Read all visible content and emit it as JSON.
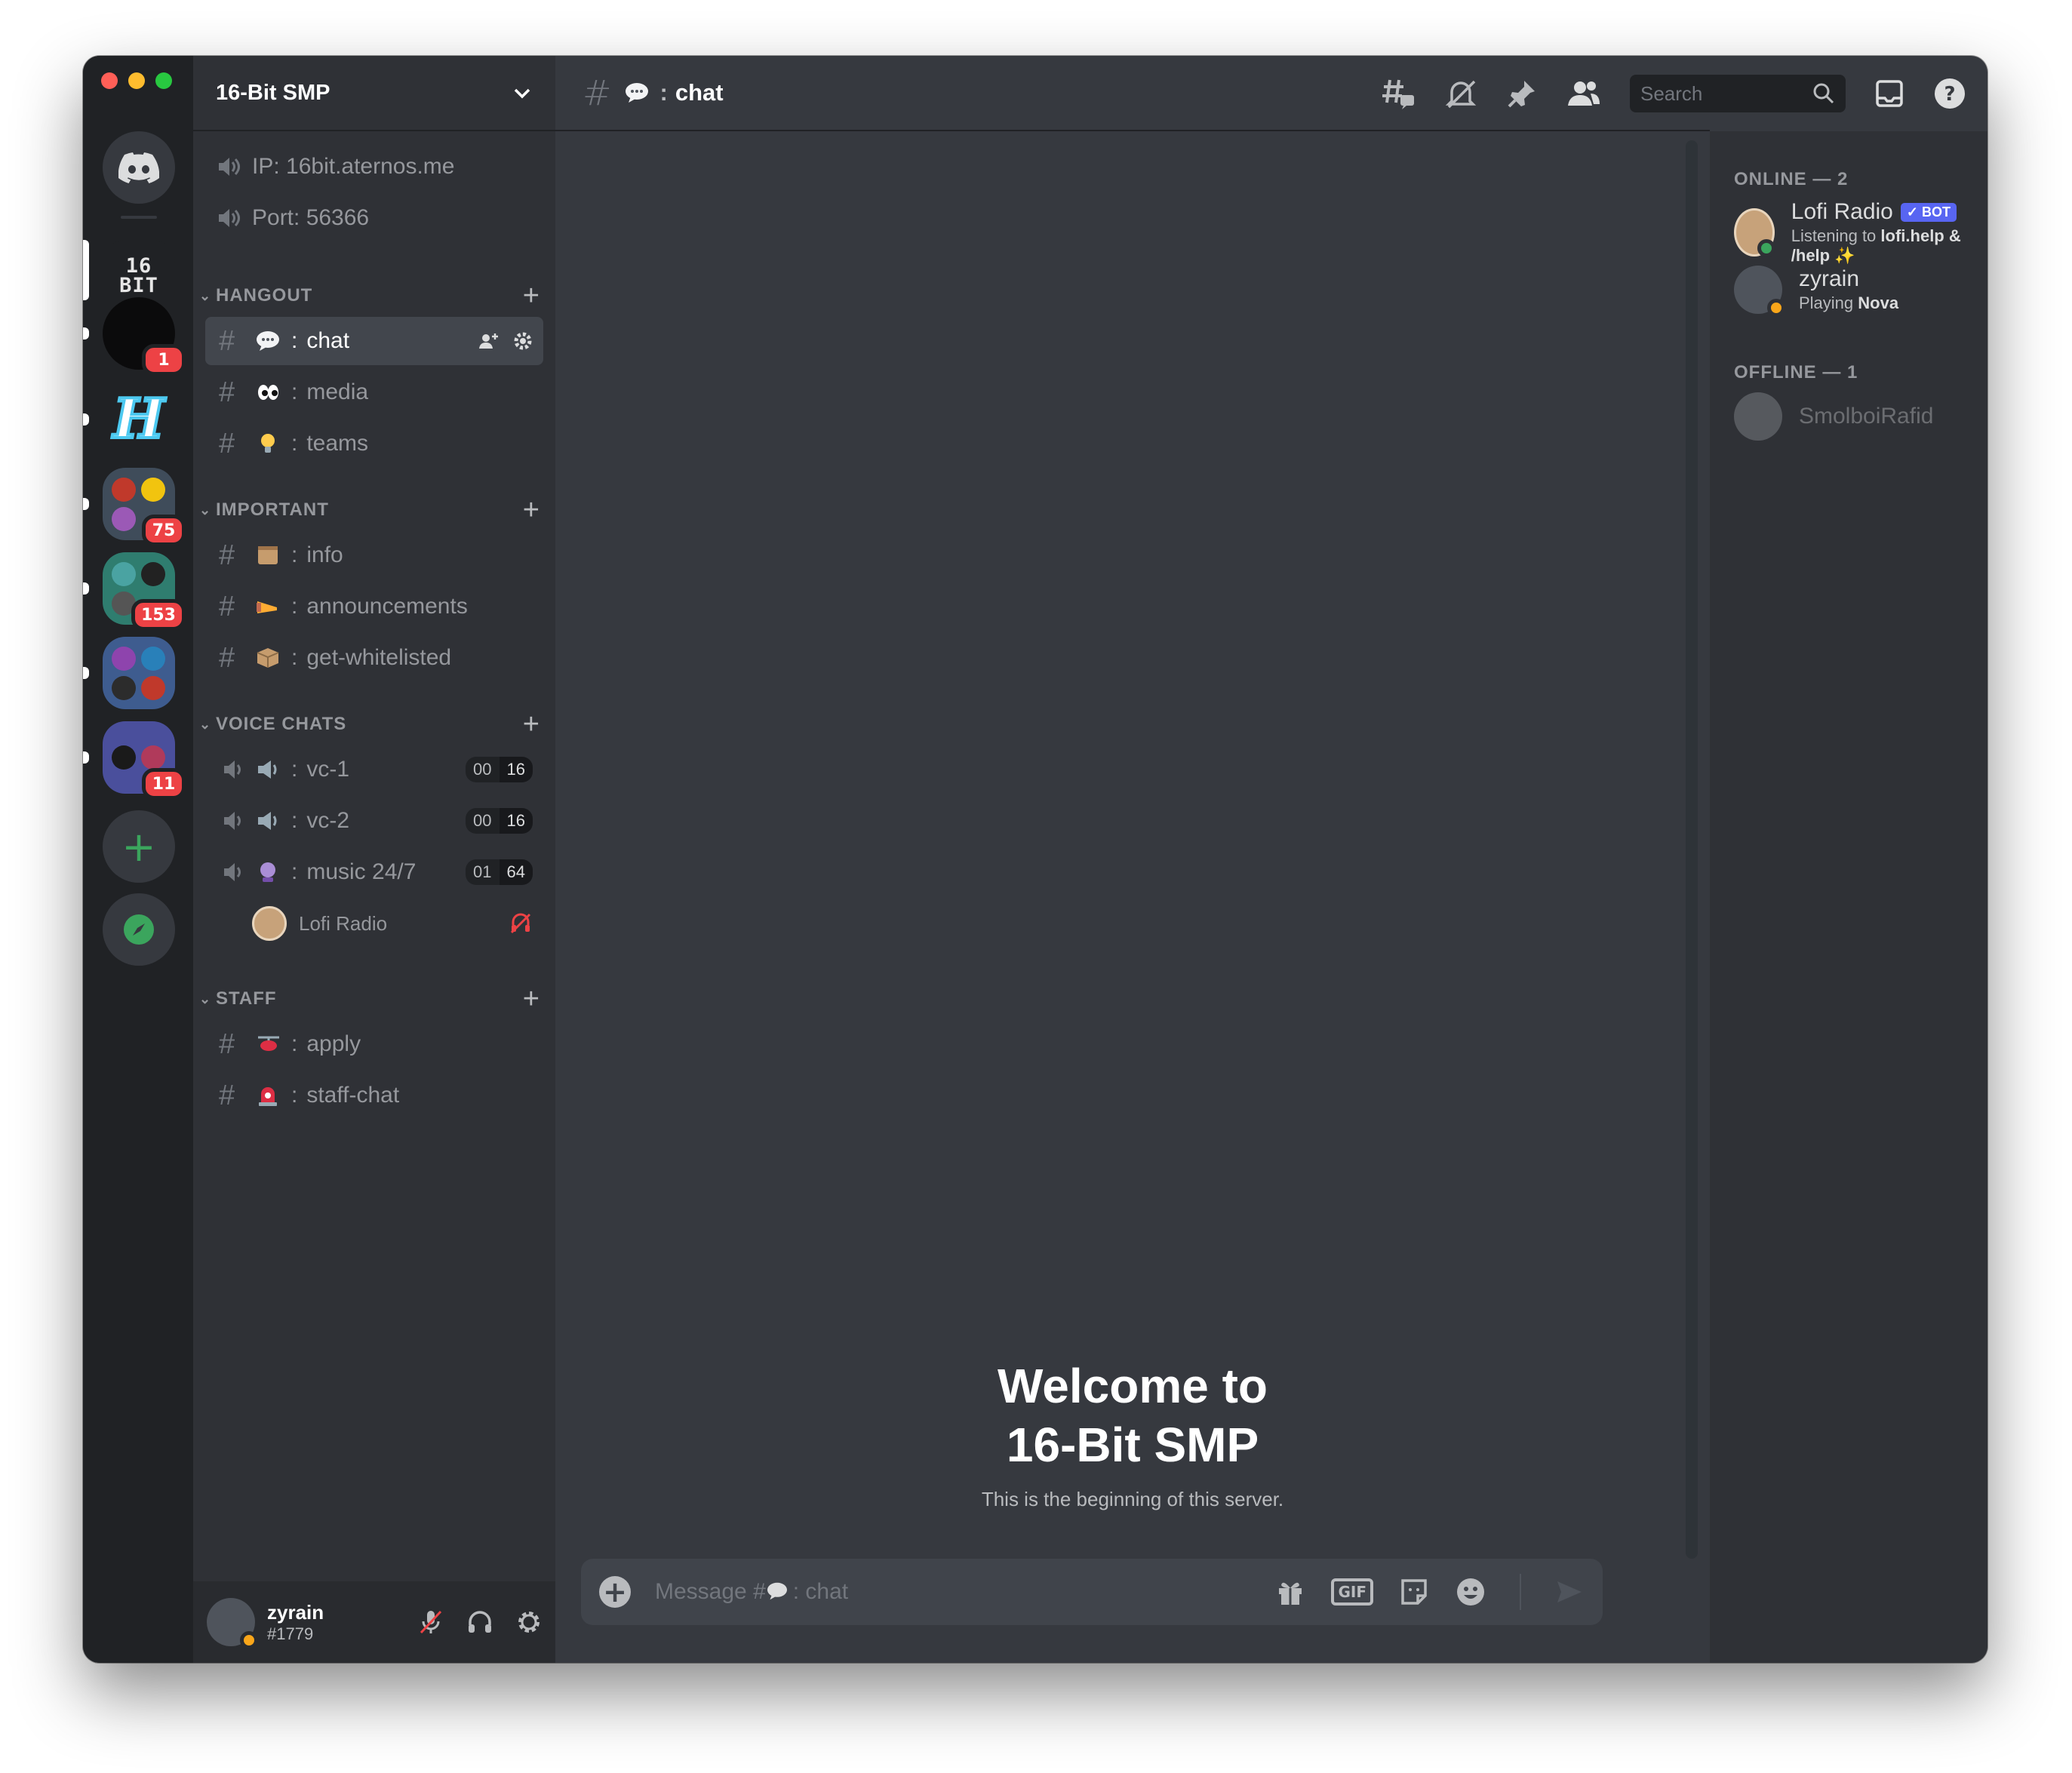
{
  "server": {
    "name": "16-Bit SMP",
    "logo_text": "16\nBIT",
    "info": [
      "IP: 16bit.aternos.me",
      "Port: 56366"
    ]
  },
  "rail": {
    "badges": [
      "1",
      "75",
      "153",
      "11"
    ],
    "add_label": "+"
  },
  "categories": {
    "hangout": "HANGOUT",
    "important": "IMPORTANT",
    "voice": "VOICE CHATS",
    "staff": "STAFF"
  },
  "channels": {
    "chat": "chat",
    "media": "media",
    "teams": "teams",
    "info": "info",
    "announcements": "announcements",
    "get_whitelisted": "get-whitelisted",
    "apply": "apply",
    "staff_chat": "staff-chat"
  },
  "voice": [
    {
      "name": "vc-1",
      "count": "00",
      "limit": "16"
    },
    {
      "name": "vc-2",
      "count": "00",
      "limit": "16"
    },
    {
      "name": "music 24/7",
      "count": "01",
      "limit": "64"
    }
  ],
  "voice_user": "Lofi Radio",
  "user": {
    "name": "zyrain",
    "tag": "#1779"
  },
  "header": {
    "channel": "chat",
    "search_placeholder": "Search"
  },
  "welcome": {
    "line1": "Welcome to",
    "line2": "16-Bit SMP",
    "subtitle": "This is the beginning of this server."
  },
  "composer": {
    "placeholder_prefix": "Message #",
    "placeholder_channel": ": chat",
    "gif": "GIF"
  },
  "members": {
    "online_header": "ONLINE — 2",
    "offline_header": "OFFLINE — 1",
    "online": [
      {
        "name": "Lofi Radio",
        "bot": "BOT",
        "activity": "Listening to",
        "detail": "lofi.help & /help ✨"
      },
      {
        "name": "zyrain",
        "activity": "Playing",
        "detail": "Nova"
      }
    ],
    "offline": [
      {
        "name": "SmolboiRafid"
      }
    ]
  },
  "colors": {
    "accent": "#5865f2",
    "online": "#3ba55d",
    "idle": "#faa61a",
    "badge": "#ed4245"
  }
}
